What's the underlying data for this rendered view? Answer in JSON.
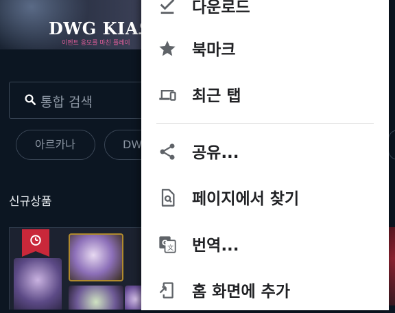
{
  "banner": {
    "title": "DWG KIA오",
    "subtitle": "이벤트 응모를 마친 플레이"
  },
  "search": {
    "placeholder": "통합 검색"
  },
  "chips": [
    {
      "label": "아르카나"
    },
    {
      "label": "DW"
    }
  ],
  "section": {
    "title": "신규상품"
  },
  "menu": {
    "items": [
      {
        "label": "다운로드",
        "icon": "download-done-icon"
      },
      {
        "label": "북마크",
        "icon": "star-icon"
      },
      {
        "label": "최근 탭",
        "icon": "devices-icon"
      },
      {
        "label": "공유...",
        "icon": "share-icon"
      },
      {
        "label": "페이지에서 찾기",
        "icon": "find-in-page-icon"
      },
      {
        "label": "번역...",
        "icon": "translate-icon"
      },
      {
        "label": "홈 화면에 추가",
        "icon": "add-to-home-screen-icon"
      }
    ]
  },
  "colors": {
    "page_background": "#0c1622",
    "menu_background": "#ffffff",
    "menu_text": "#202124",
    "menu_icon": "#5f6368"
  }
}
